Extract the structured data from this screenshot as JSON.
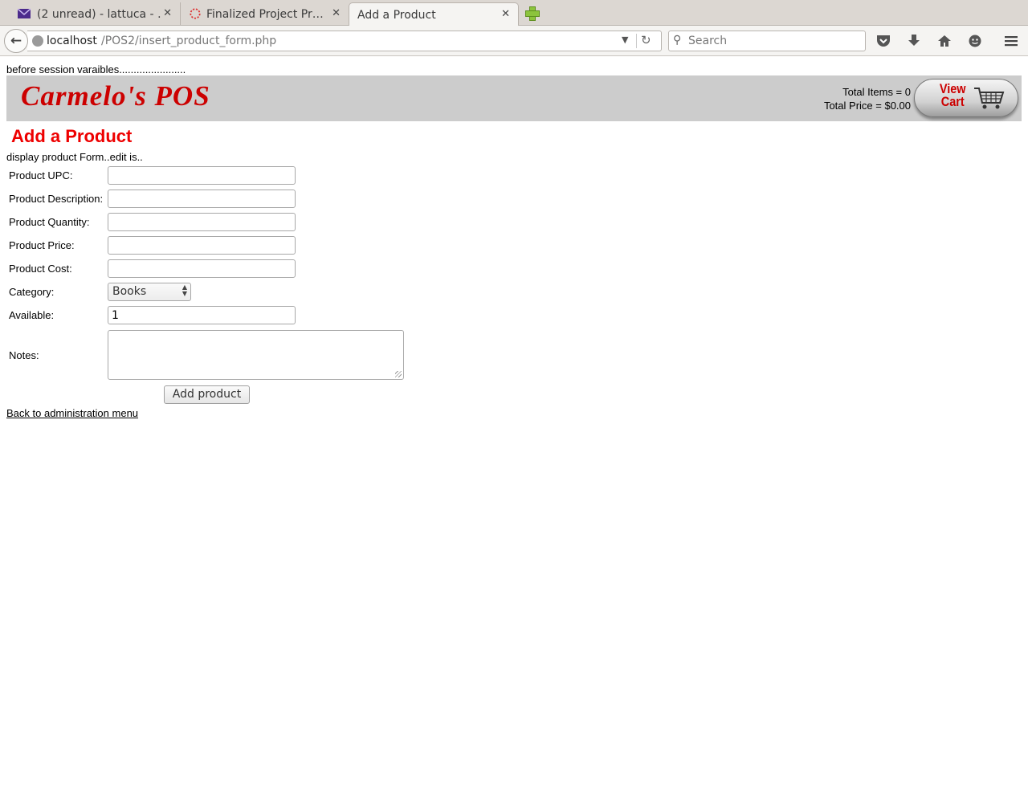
{
  "browser": {
    "tabs": [
      {
        "title": "(2 unread) - lattuca - …",
        "icon": "envelope-icon"
      },
      {
        "title": "Finalized Project Pr…",
        "icon": "loading-spinner-icon"
      },
      {
        "title": "Add a Product",
        "icon": ""
      }
    ],
    "url_host": "localhost",
    "url_path": "/POS2/insert_product_form.php",
    "search_placeholder": "Search",
    "close_glyph": "✕"
  },
  "page": {
    "debug_session": "before session varaibles.......................",
    "brand": "Carmelo's POS",
    "cart": {
      "total_items": "Total Items = 0",
      "total_price": "Total Price = $0.00",
      "button_line1": "View",
      "button_line2": "Cart"
    },
    "title": "Add a Product",
    "debug_form": "display product Form..edit is..",
    "form": {
      "upc_label": "Product UPC:",
      "upc_value": "",
      "description_label": "Product Description:",
      "description_value": "",
      "quantity_label": "Product Quantity:",
      "quantity_value": "",
      "price_label": "Product Price:",
      "price_value": "",
      "cost_label": "Product Cost:",
      "cost_value": "",
      "category_label": "Category:",
      "category_selected": "Books",
      "available_label": "Available:",
      "available_value": "1",
      "notes_label": "Notes:",
      "submit_label": "Add product"
    },
    "back_link": "Back to administration menu"
  },
  "colors": {
    "brand_red": "#cc0000",
    "title_red": "#ee0000",
    "header_gray": "#cccccc"
  }
}
